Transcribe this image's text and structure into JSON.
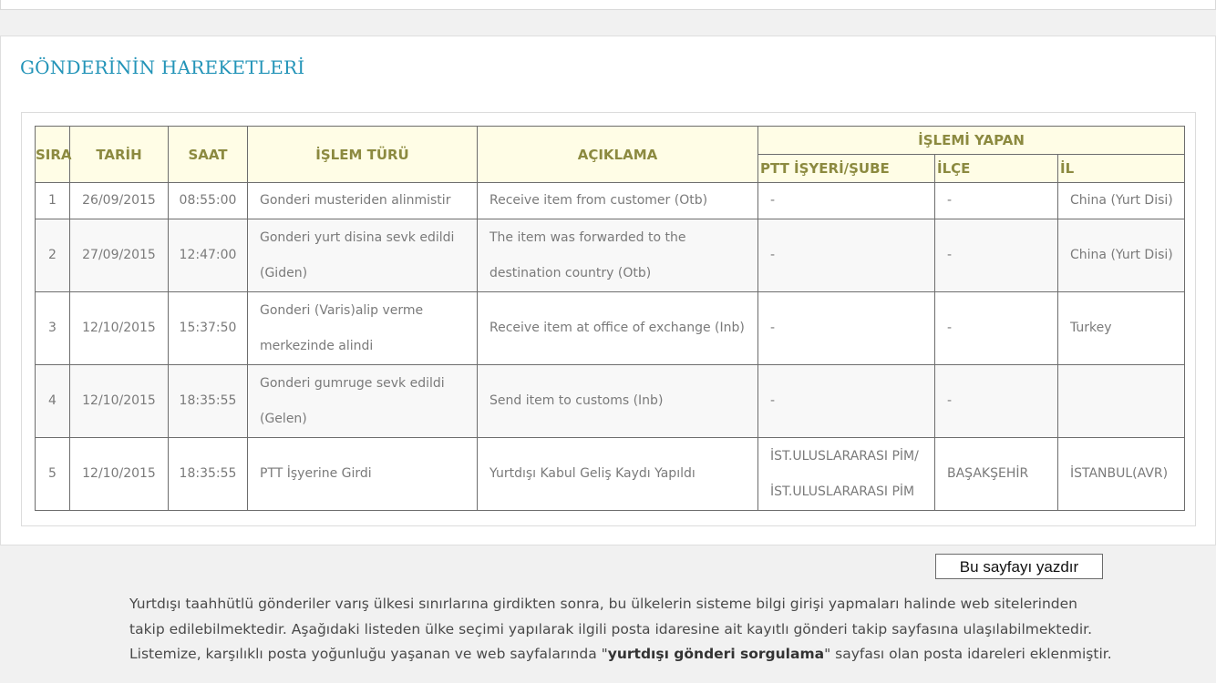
{
  "section_title": "GÖNDERİNİN HAREKETLERİ",
  "table": {
    "headers": {
      "sira": "SIRA",
      "tarih": "TARİH",
      "saat": "SAAT",
      "islem_turu": "İŞLEM TÜRÜ",
      "aciklama": "AÇIKLAMA",
      "islemi_yapan": "İŞLEMİ YAPAN",
      "isyeri": "PTT İŞYERİ/ŞUBE",
      "ilce": "İLÇE",
      "il": "İL"
    },
    "rows": [
      {
        "sira": "1",
        "tarih": "26/09/2015",
        "saat": "08:55:00",
        "islem_turu": [
          "Gonderi musteriden alinmistir"
        ],
        "aciklama": [
          "Receive item from customer (Otb)"
        ],
        "isyeri": [
          "-"
        ],
        "ilce": "-",
        "il": "China (Yurt Disi)"
      },
      {
        "sira": "2",
        "tarih": "27/09/2015",
        "saat": "12:47:00",
        "islem_turu": [
          "Gonderi yurt disina sevk edildi",
          "(Giden)"
        ],
        "aciklama": [
          "The item was forwarded to the",
          "destination country (Otb)"
        ],
        "isyeri": [
          "-"
        ],
        "ilce": "-",
        "il": "China (Yurt Disi)"
      },
      {
        "sira": "3",
        "tarih": "12/10/2015",
        "saat": "15:37:50",
        "islem_turu": [
          "Gonderi (Varis)alip verme",
          "merkezinde alindi"
        ],
        "aciklama": [
          "Receive item at office of exchange (Inb)"
        ],
        "isyeri": [
          "-"
        ],
        "ilce": "-",
        "il": "Turkey"
      },
      {
        "sira": "4",
        "tarih": "12/10/2015",
        "saat": "18:35:55",
        "islem_turu": [
          "Gonderi gumruge sevk edildi",
          "(Gelen)"
        ],
        "aciklama": [
          "Send item to customs (Inb)"
        ],
        "isyeri": [
          "-"
        ],
        "ilce": "-",
        "il": ""
      },
      {
        "sira": "5",
        "tarih": "12/10/2015",
        "saat": "18:35:55",
        "islem_turu": [
          "PTT İşyerine Girdi"
        ],
        "aciklama": [
          "Yurtdışı Kabul Geliş Kaydı Yapıldı"
        ],
        "isyeri": [
          "İST.ULUSLARARASI PİM/",
          "İST.ULUSLARARASI PİM"
        ],
        "ilce": "BAŞAKŞEHİR",
        "il": "İSTANBUL(AVR)"
      }
    ]
  },
  "print_button": "Bu sayfayı yazdır",
  "info": {
    "part1": "Yurtdışı taahhütlü gönderiler varış ülkesi sınırlarına girdikten sonra, bu ülkelerin sisteme bilgi girişi yapmaları halinde web sitelerinden takip edilebilmektedir. Aşağıdaki listeden ülke seçimi yapılarak ilgili posta idaresine ait  kayıtlı gönderi takip  sayfasına ulaşılabilmektedir. Listemize, karşılıklı posta yoğunluğu yaşanan ve web sayfalarında \"",
    "bold": "yurtdışı gönderi sorgulama",
    "part2": "\" sayfası olan posta idareleri eklenmiştir."
  }
}
